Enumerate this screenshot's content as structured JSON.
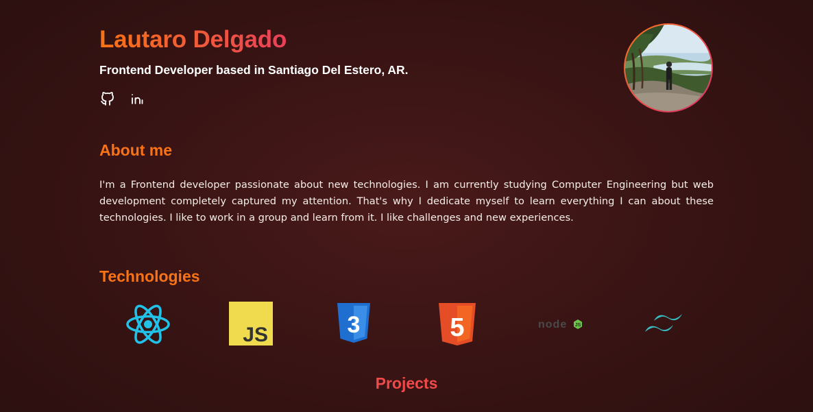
{
  "header": {
    "name": "Lautaro Delgado",
    "role": "Frontend Developer based in Santiago Del Estero, AR.",
    "socials": [
      {
        "icon": "github-icon"
      },
      {
        "icon": "linkedin-icon"
      }
    ],
    "avatar": "profile-photo"
  },
  "about": {
    "title": "About me",
    "text": "I'm a Frontend developer passionate about new technologies. I am currently studying Computer Engineering but web development completely captured my attention. That's why I dedicate myself to learn everything I can about these technologies. I like to work in a group and learn from it. I like challenges and new experiences."
  },
  "technologies": {
    "title": "Technologies",
    "items": [
      {
        "icon": "react-icon",
        "color": "#22c1e8"
      },
      {
        "icon": "javascript-icon",
        "label": "JS",
        "color": "#f0db4f"
      },
      {
        "icon": "css3-icon",
        "label": "3",
        "color": "#1f6fd1"
      },
      {
        "icon": "html5-icon",
        "label": "5",
        "color": "#f26522"
      },
      {
        "icon": "nodejs-icon",
        "label": "node",
        "color": "#6cc24a"
      },
      {
        "icon": "tailwind-icon",
        "color": "#38bdc4"
      }
    ]
  },
  "projects": {
    "title": "Projects"
  },
  "colors": {
    "accent": "#f97316",
    "accent_pink": "#e9405a",
    "projects_title": "#ef4a4a",
    "background": "#3a1414"
  }
}
